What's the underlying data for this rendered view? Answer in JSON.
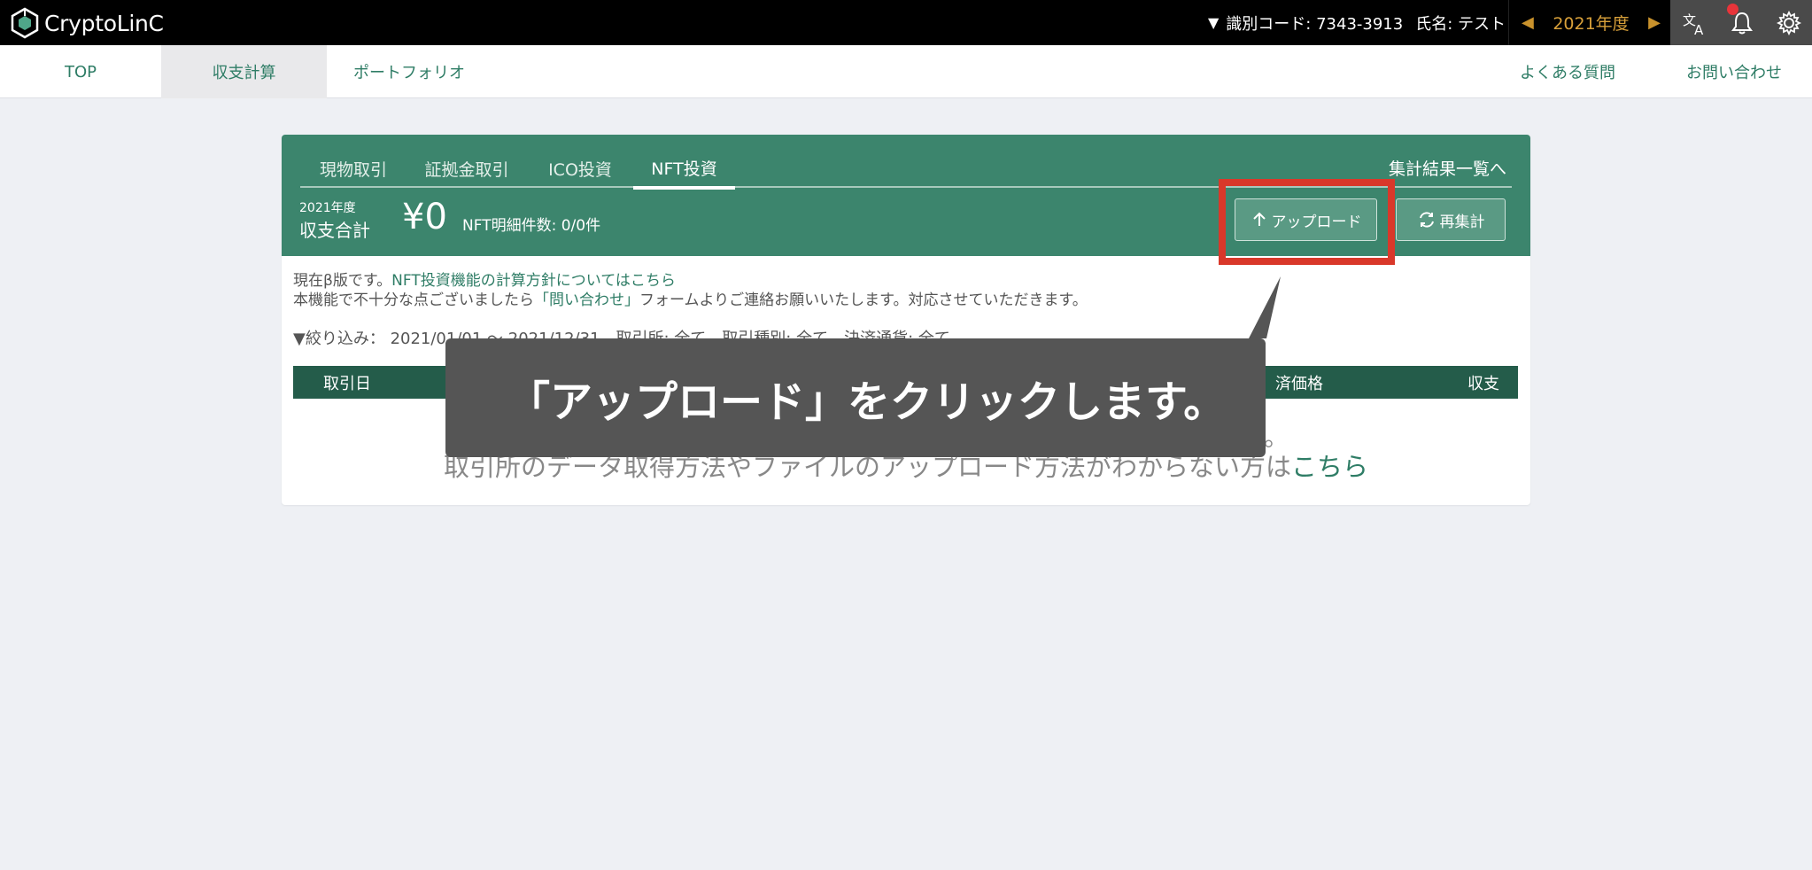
{
  "header": {
    "logo_text": "CryptoLinC",
    "id_label": "識別コード: 7343-3913",
    "name_label": "氏名: テスト",
    "year": "2021年度",
    "icons": [
      "translate-icon",
      "bell-icon",
      "gear-icon"
    ],
    "accent_color": "#d8a03a"
  },
  "nav": {
    "top": "TOP",
    "shushi": "収支計算",
    "portfolio": "ポートフォリオ",
    "faq": "よくある質問",
    "contact": "お問い合わせ"
  },
  "card": {
    "tabs": [
      "現物取引",
      "証拠金取引",
      "ICO投資",
      "NFT投資"
    ],
    "active_tab": "NFT投資",
    "summary_link": "集計結果一覧へ",
    "year_label": "2021年度",
    "total_label": "収支合計",
    "amount": "¥0",
    "nft_count": "NFT明細件数: 0/0件",
    "upload_label": "アップロード",
    "recalc_label": "再集計",
    "notice_prefix": "現在β版です。",
    "notice_link": "NFT投資機能の計算方針についてはこちら",
    "notice2_prefix": "本機能で不十分な点ございましたら",
    "notice2_link": "「問い合わせ」",
    "notice2_suffix": "フォームよりご連絡お願いいたします。対応させていただきます。",
    "filter_text": "▼絞り込み： 2021/01/01 〜 2021/12/31　取引所: 全て　取引種別: 全て　決済通貨: 全て",
    "table_headers": {
      "date": "取引日",
      "price": "済価格",
      "pl": "収支"
    },
    "empty_tail": "。",
    "empty_help_prefix": "取引所のデータ取得方法やファイルのアップロード方法がわからない方は",
    "empty_help_link": "こちら",
    "brand_color": "#3c856d"
  },
  "tooltip": {
    "text": "「アップロード」をクリックします。"
  }
}
